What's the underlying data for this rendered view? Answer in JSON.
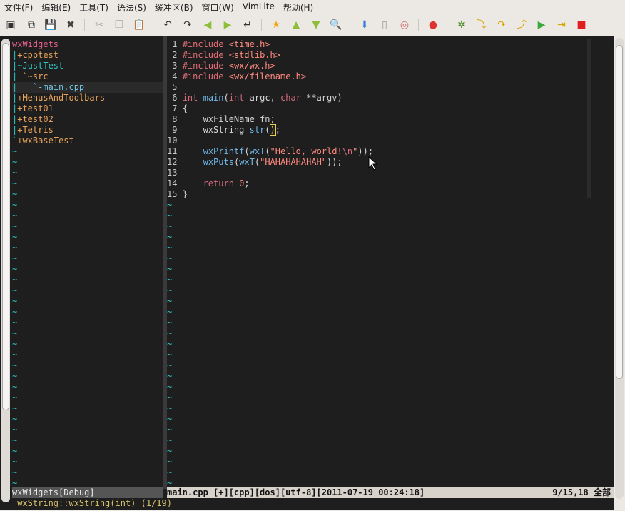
{
  "menubar": [
    "文件(F)",
    "编辑(E)",
    "工具(T)",
    "语法(S)",
    "缓冲区(B)",
    "窗口(W)",
    "VimLite",
    "帮助(H)"
  ],
  "toolbar": [
    "open-icon",
    "load-session-icon",
    "save-icon",
    "close-icon",
    "cut-icon",
    "copy-icon",
    "paste-icon",
    "undo-icon",
    "redo-icon",
    "back-icon",
    "forward-icon",
    "jump-icon",
    "star-icon",
    "up-icon",
    "down-icon",
    "search-icon",
    "download-icon",
    "trash-icon",
    "palette-icon",
    "bookmark-icon",
    "debug-icon",
    "step-into-icon",
    "step-over-icon",
    "step-out-icon",
    "continue-icon",
    "run-to-cursor-icon",
    "stop-icon"
  ],
  "tree": [
    {
      "text": "wxWidgets",
      "kind": "root"
    },
    {
      "bar": "|",
      "text": "+cpptest",
      "kind": "dir"
    },
    {
      "bar": "|",
      "text": "~JustTest",
      "kind": "open"
    },
    {
      "bar": "| ",
      "text": "`~src",
      "kind": "dir"
    },
    {
      "bar": "|   ",
      "text": "`-main.cpp",
      "kind": "file",
      "cursor": true
    },
    {
      "bar": "|",
      "text": "+MenusAndToolbars",
      "kind": "dir"
    },
    {
      "bar": "|",
      "text": "+test01",
      "kind": "dir"
    },
    {
      "bar": "|",
      "text": "+test02",
      "kind": "dir"
    },
    {
      "bar": "|",
      "text": "+Tetris",
      "kind": "dir"
    },
    {
      "bar": "`",
      "text": "+wxBaseTest",
      "kind": "dir"
    }
  ],
  "code": [
    {
      "n": " 1",
      "parts": [
        [
          "pre",
          "#include "
        ],
        [
          "inc",
          "<time.h>"
        ]
      ]
    },
    {
      "n": " 2",
      "parts": [
        [
          "pre",
          "#include "
        ],
        [
          "inc",
          "<stdlib.h>"
        ]
      ]
    },
    {
      "n": " 3",
      "parts": [
        [
          "pre",
          "#include "
        ],
        [
          "inc",
          "<wx/wx.h>"
        ]
      ]
    },
    {
      "n": " 4",
      "parts": [
        [
          "pre",
          "#include "
        ],
        [
          "inc",
          "<wx/filename.h>"
        ]
      ]
    },
    {
      "n": " 5",
      "parts": []
    },
    {
      "n": " 6",
      "parts": [
        [
          "kw",
          "int "
        ],
        [
          "fn",
          "main"
        ],
        [
          "punc",
          "("
        ],
        [
          "kw",
          "int "
        ],
        [
          "ident",
          "argc, "
        ],
        [
          "kw",
          "char "
        ],
        [
          "ident",
          "**argv)"
        ]
      ]
    },
    {
      "n": " 7",
      "parts": [
        [
          "punc",
          "{"
        ]
      ]
    },
    {
      "n": " 8",
      "parts": [
        [
          "ident",
          "    wxFileName fn;"
        ]
      ]
    },
    {
      "n": " 9",
      "parts": [
        [
          "ident",
          "    wxString "
        ],
        [
          "fn",
          "str"
        ],
        [
          "punc",
          "("
        ],
        [
          "cur",
          ")"
        ],
        [
          "punc",
          ";"
        ]
      ]
    },
    {
      "n": "10",
      "parts": []
    },
    {
      "n": "11",
      "parts": [
        [
          "ident",
          "    "
        ],
        [
          "fn",
          "wxPrintf"
        ],
        [
          "punc",
          "("
        ],
        [
          "fn",
          "wxT"
        ],
        [
          "punc",
          "("
        ],
        [
          "str",
          "\"Hello, world!"
        ],
        [
          "kw",
          "\\n"
        ],
        [
          "str",
          "\""
        ],
        [
          "punc",
          "));"
        ]
      ]
    },
    {
      "n": "12",
      "parts": [
        [
          "ident",
          "    "
        ],
        [
          "fn",
          "wxPuts"
        ],
        [
          "punc",
          "("
        ],
        [
          "fn",
          "wxT"
        ],
        [
          "punc",
          "("
        ],
        [
          "str",
          "\"HAHAHAHAHAH\""
        ],
        [
          "punc",
          "));"
        ]
      ]
    },
    {
      "n": "13",
      "parts": []
    },
    {
      "n": "14",
      "parts": [
        [
          "kw",
          "    return "
        ],
        [
          "inc",
          "0"
        ],
        [
          "punc",
          ";"
        ]
      ]
    },
    {
      "n": "15",
      "parts": [
        [
          "punc",
          "}"
        ]
      ]
    }
  ],
  "tilde": "~",
  "status_left": "wxWidgets[Debug]",
  "status_right": "main.cpp [+][cpp][dos][utf-8][2011-07-19 00:24:18]",
  "status_pos": "9/15,18 全部",
  "cmdline": " wxString::wxString(int) (1/19)"
}
